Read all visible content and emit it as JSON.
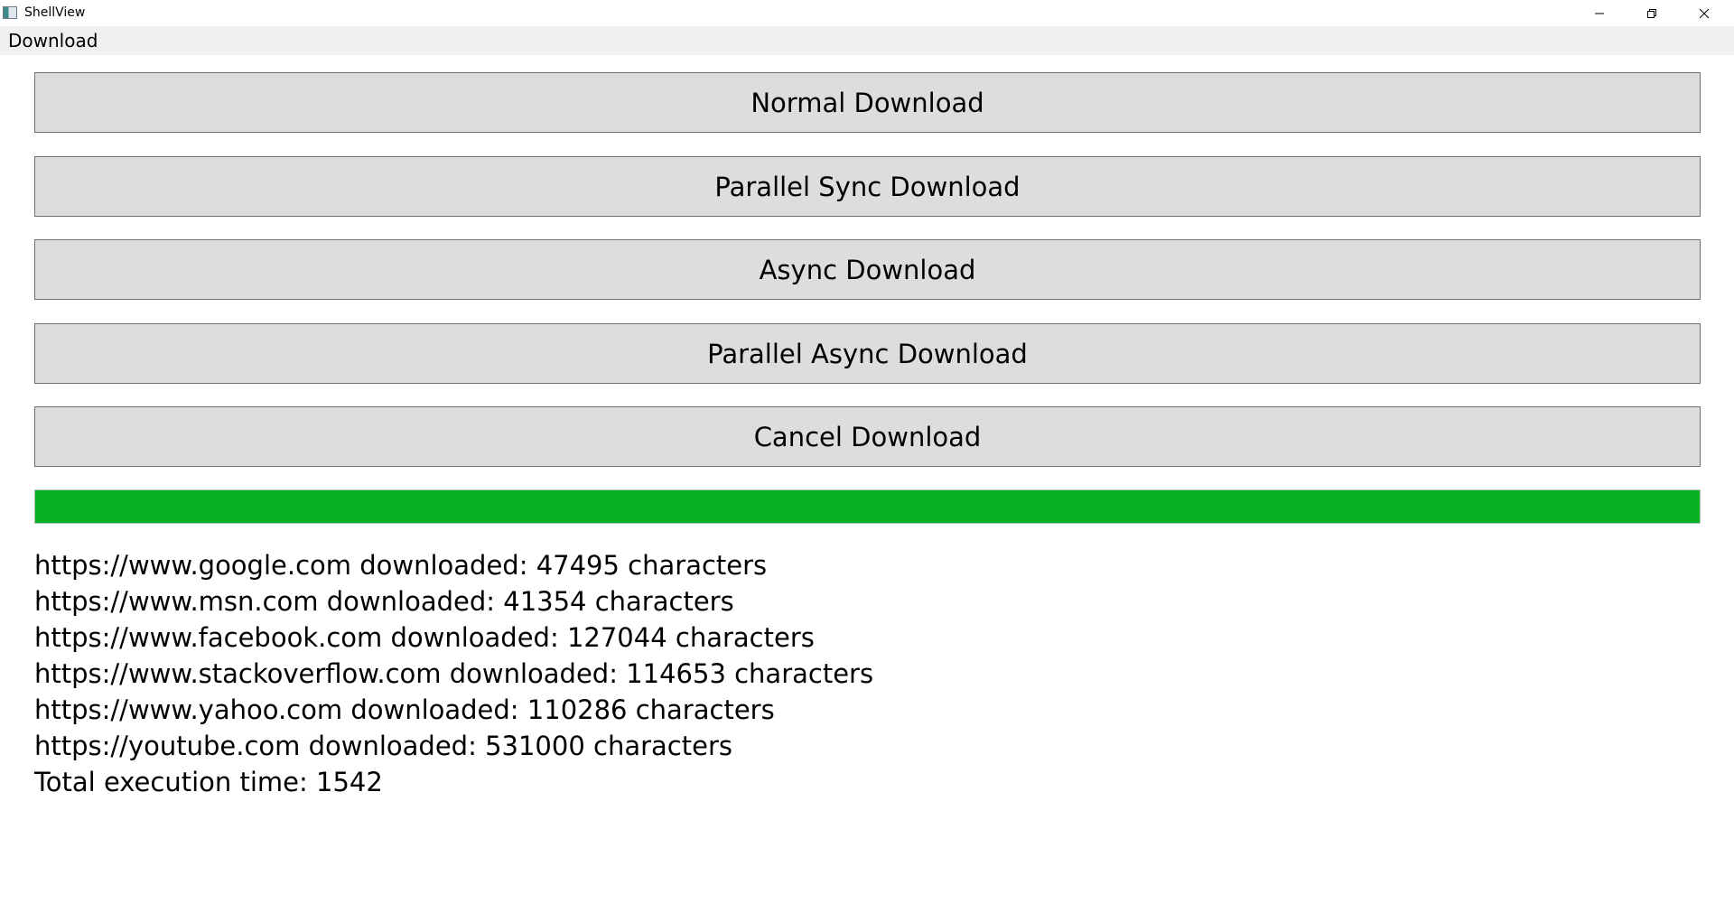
{
  "window": {
    "title": "ShellView",
    "icon": "app-window-icon"
  },
  "menu": {
    "items": [
      {
        "label": "Download"
      }
    ]
  },
  "buttons": {
    "normal": "Normal Download",
    "parallel_sync": "Parallel Sync Download",
    "async": "Async Download",
    "parallel_async": "Parallel Async Download",
    "cancel": "Cancel Download"
  },
  "progress": {
    "value_percent": 100,
    "color": "#06b025"
  },
  "log": {
    "lines": [
      "https://www.google.com downloaded: 47495 characters",
      "https://www.msn.com downloaded: 41354 characters",
      "https://www.facebook.com downloaded: 127044 characters",
      "https://www.stackoverflow.com downloaded: 114653 characters",
      "https://www.yahoo.com downloaded: 110286 characters",
      "https://youtube.com downloaded: 531000 characters",
      "Total execution time: 1542"
    ]
  }
}
